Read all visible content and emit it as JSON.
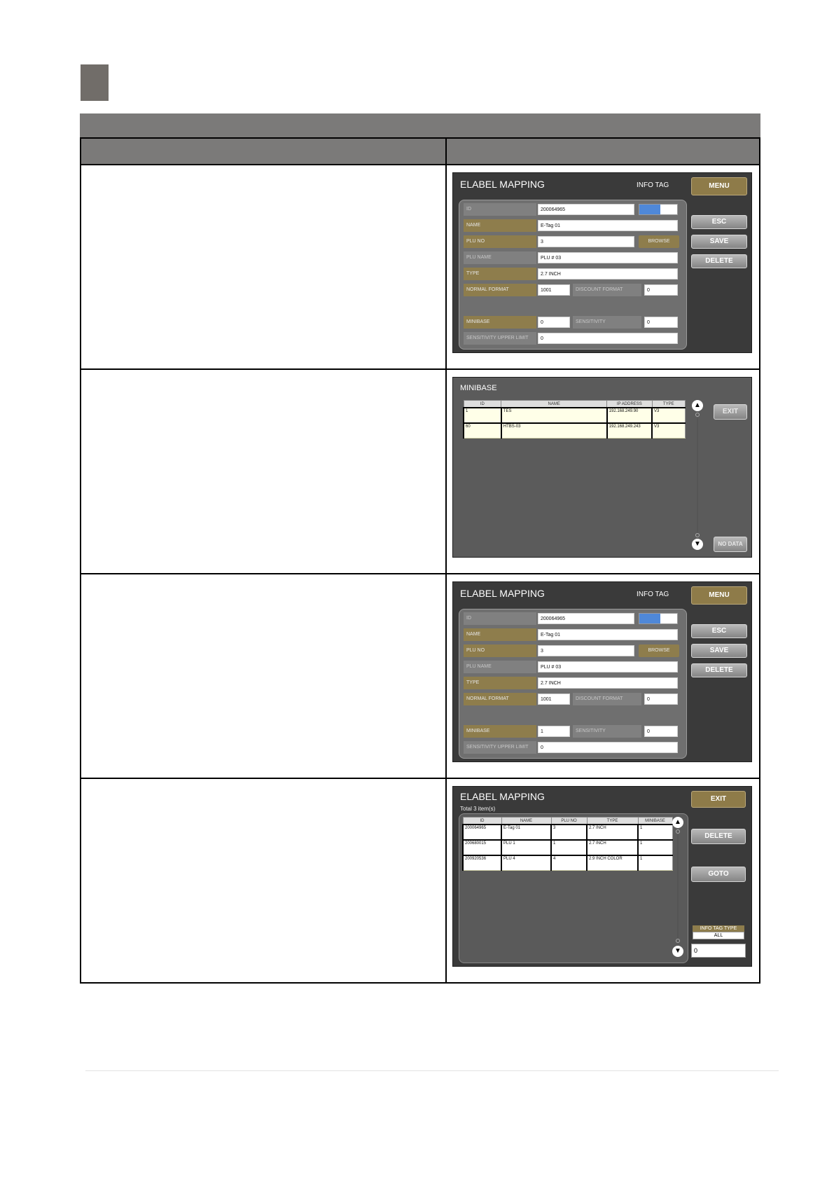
{
  "mapping_screen_1": {
    "title": "ELABEL MAPPING",
    "info_tag": "INFO TAG",
    "menu": "MENU",
    "esc": "ESC",
    "save": "SAVE",
    "delete": "DELETE",
    "browse": "BROWSE",
    "labels": {
      "id": "ID",
      "name": "NAME",
      "plu_no": "PLU NO",
      "plu_name": "PLU NAME",
      "type": "TYPE",
      "normal_format": "NORMAL FORMAT",
      "discount_format": "DISCOUNT FORMAT",
      "minibase": "MINIBASE",
      "sensitivity": "SENSITIVITY",
      "sensitivity_upper_limit": "SENSITIVITY UPPER LIMIT"
    },
    "values": {
      "id": "200064965",
      "name": "E-Tag 01",
      "plu_no": "3",
      "plu_name": "PLU # 03",
      "type": "2.7 INCH",
      "normal_format": "1001",
      "discount_format": "0",
      "minibase": "0",
      "sensitivity": "0",
      "sensitivity_upper_limit": "0"
    }
  },
  "minibase_screen": {
    "title": "MINIBASE",
    "columns": [
      "ID",
      "NAME",
      "IP ADDRESS",
      "TYPE"
    ],
    "rows": [
      [
        "1",
        "TES",
        "192.168.249.90",
        "V3"
      ],
      [
        "60",
        "HTBS-03",
        "192.168.249.243",
        "V3"
      ]
    ],
    "exit": "EXIT",
    "no_data": "NO DATA"
  },
  "mapping_screen_2": {
    "title": "ELABEL MAPPING",
    "info_tag": "INFO TAG",
    "menu": "MENU",
    "esc": "ESC",
    "save": "SAVE",
    "delete": "DELETE",
    "browse": "BROWSE",
    "labels": {
      "id": "ID",
      "name": "NAME",
      "plu_no": "PLU NO",
      "plu_name": "PLU NAME",
      "type": "TYPE",
      "normal_format": "NORMAL FORMAT",
      "discount_format": "DISCOUNT FORMAT",
      "minibase": "MINIBASE",
      "sensitivity": "SENSITIVITY",
      "sensitivity_upper_limit": "SENSITIVITY UPPER LIMIT"
    },
    "values": {
      "id": "200064965",
      "name": "E-Tag 01",
      "plu_no": "3",
      "plu_name": "PLU # 03",
      "type": "2.7 INCH",
      "normal_format": "1001",
      "discount_format": "0",
      "minibase": "1",
      "sensitivity": "0",
      "sensitivity_upper_limit": "0"
    }
  },
  "list_screen": {
    "title": "ELABEL MAPPING",
    "subtitle": "Total 3 item(s)",
    "columns": [
      "ID",
      "NAME",
      "PLU NO",
      "TYPE",
      "MINIBASE"
    ],
    "rows": [
      [
        "200064965",
        "E-Tag 01",
        "3",
        "2.7 INCH",
        "1"
      ],
      [
        "200680015",
        "PLU 1",
        "1",
        "2.7 INCH",
        "1"
      ],
      [
        "200920536",
        "PLU 4",
        "4",
        "2.9 INCH COLOR",
        "1"
      ]
    ],
    "exit": "EXIT",
    "delete": "DELETE",
    "goto": "GOTO",
    "filter_label": "INFO TAG TYPE",
    "filter_value": "ALL",
    "count_value": "0"
  },
  "colors": {
    "gold": "#8e7b49",
    "panel_grey": "#6f6f6f",
    "screen_bg": "#3a3a3a",
    "toggle_blue": "#4f88d8",
    "header_grey": "#7b7a79"
  },
  "icons": [
    "arrow-up-icon",
    "arrow-down-icon",
    "scroll-dot-icon"
  ]
}
